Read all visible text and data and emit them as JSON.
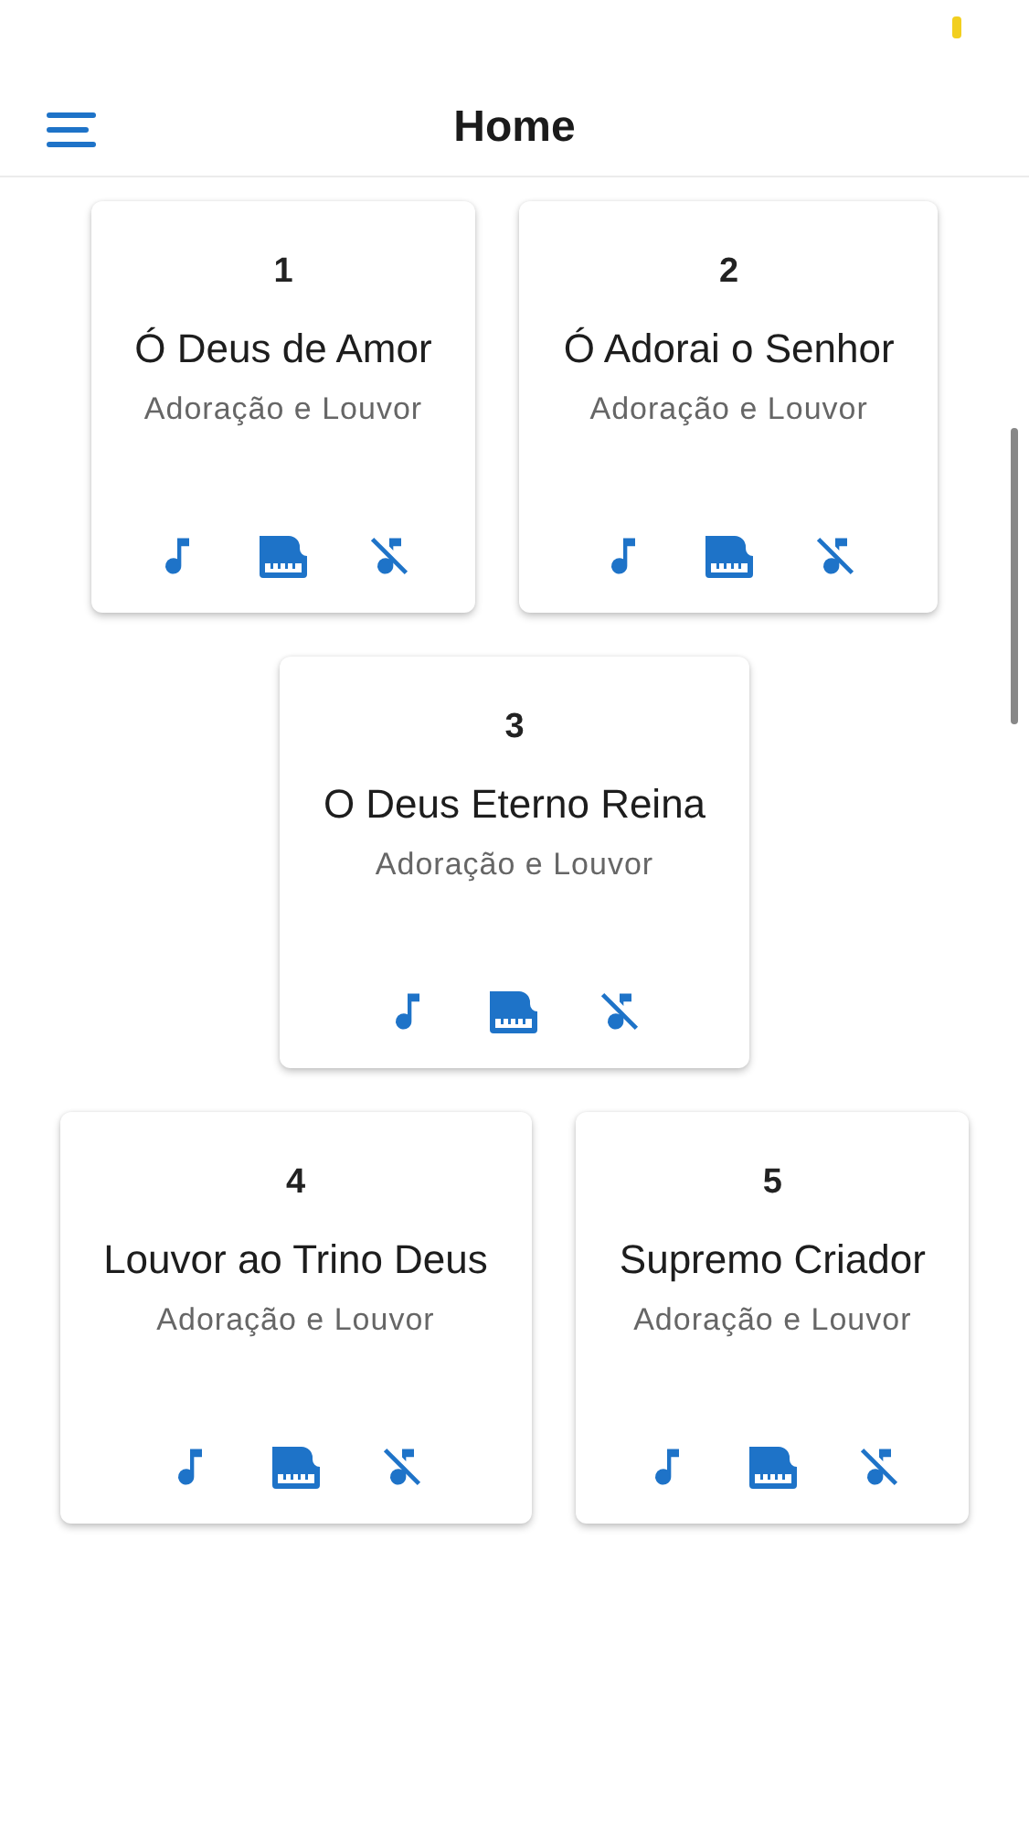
{
  "app_bar": {
    "title": "Home"
  },
  "hymns": [
    {
      "number": "1",
      "title": "Ó Deus de Amor",
      "category": "Adoração e Louvor"
    },
    {
      "number": "2",
      "title": "Ó Adorai o Senhor",
      "category": "Adoração e Louvor"
    },
    {
      "number": "3",
      "title": "O Deus Eterno Reina",
      "category": "Adoração e Louvor"
    },
    {
      "number": "4",
      "title": "Louvor ao Trino Deus",
      "category": "Adoração e Louvor"
    },
    {
      "number": "5",
      "title": "Supremo Criador",
      "category": "Adoração e Louvor"
    }
  ]
}
